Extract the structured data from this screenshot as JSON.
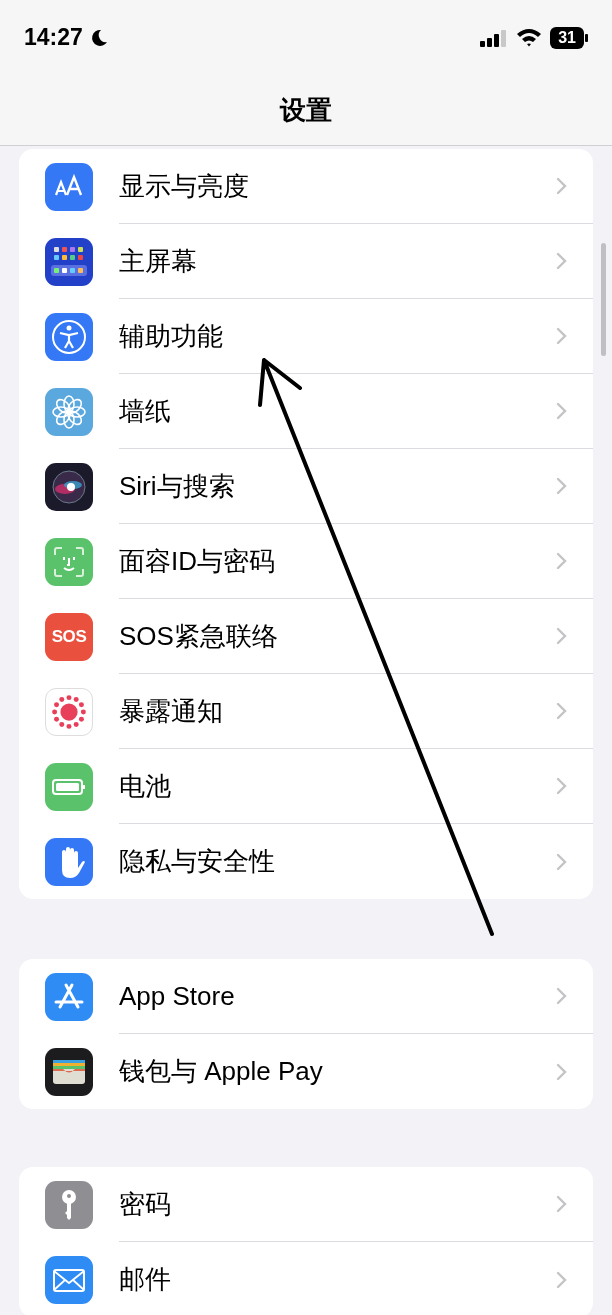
{
  "status_bar": {
    "time": "14:27",
    "battery": "31"
  },
  "title": "设置",
  "groups": [
    {
      "items": [
        {
          "label": "显示与亮度",
          "kind": "display"
        },
        {
          "label": "主屏幕",
          "kind": "home"
        },
        {
          "label": "辅助功能",
          "kind": "accessibility"
        },
        {
          "label": "墙纸",
          "kind": "wallpaper"
        },
        {
          "label": "Siri与搜索",
          "kind": "siri"
        },
        {
          "label": "面容ID与密码",
          "kind": "faceid"
        },
        {
          "label": "SOS紧急联络",
          "kind": "sos",
          "icon_text": "SOS"
        },
        {
          "label": "暴露通知",
          "kind": "exposure"
        },
        {
          "label": "电池",
          "kind": "battery"
        },
        {
          "label": "隐私与安全性",
          "kind": "privacy"
        }
      ]
    },
    {
      "items": [
        {
          "label": "App Store",
          "kind": "appstore"
        },
        {
          "label": "钱包与 Apple Pay",
          "kind": "wallet"
        }
      ]
    },
    {
      "items": [
        {
          "label": "密码",
          "kind": "passwords"
        },
        {
          "label": "邮件",
          "kind": "mail"
        }
      ]
    }
  ]
}
